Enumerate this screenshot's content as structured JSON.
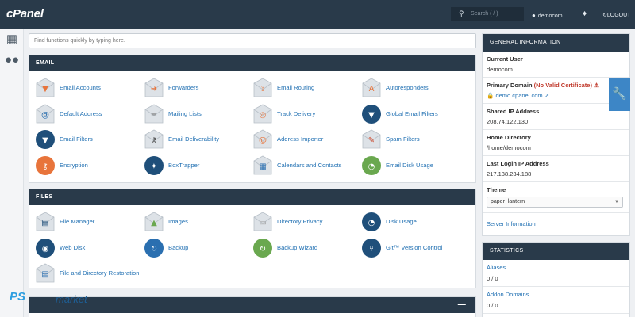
{
  "topbar": {
    "logo": "cPanel",
    "search_placeholder": "Search ( / )",
    "username": "democom",
    "logout": "LOGOUT"
  },
  "quickfind": {
    "placeholder": "Find functions quickly by typing here."
  },
  "email": {
    "title": "EMAIL",
    "items": [
      {
        "label": "Email Accounts",
        "icon": "mail-down-icon"
      },
      {
        "label": "Forwarders",
        "icon": "mail-forward-icon"
      },
      {
        "label": "Email Routing",
        "icon": "mail-routing-icon"
      },
      {
        "label": "Autoresponders",
        "icon": "mail-auto-icon"
      },
      {
        "label": "Default Address",
        "icon": "mail-at-icon"
      },
      {
        "label": "Mailing Lists",
        "icon": "mail-list-icon"
      },
      {
        "label": "Track Delivery",
        "icon": "mail-track-icon"
      },
      {
        "label": "Global Email Filters",
        "icon": "global-filter-icon"
      },
      {
        "label": "Email Filters",
        "icon": "filter-icon"
      },
      {
        "label": "Email Deliverability",
        "icon": "mail-key-icon"
      },
      {
        "label": "Address Importer",
        "icon": "mail-import-icon"
      },
      {
        "label": "Spam Filters",
        "icon": "spam-icon"
      },
      {
        "label": "Encryption",
        "icon": "key-icon"
      },
      {
        "label": "BoxTrapper",
        "icon": "boxtrapper-icon"
      },
      {
        "label": "Calendars and Contacts",
        "icon": "calendar-icon"
      },
      {
        "label": "Email Disk Usage",
        "icon": "mail-pie-icon"
      }
    ]
  },
  "files": {
    "title": "FILES",
    "items": [
      {
        "label": "File Manager",
        "icon": "file-manager-icon"
      },
      {
        "label": "Images",
        "icon": "images-icon"
      },
      {
        "label": "Directory Privacy",
        "icon": "folder-icon"
      },
      {
        "label": "Disk Usage",
        "icon": "disk-icon"
      },
      {
        "label": "Web Disk",
        "icon": "web-disk-icon"
      },
      {
        "label": "Backup",
        "icon": "backup-icon"
      },
      {
        "label": "Backup Wizard",
        "icon": "backup-wizard-icon"
      },
      {
        "label": "Git™ Version Control",
        "icon": "git-icon"
      },
      {
        "label": "File and Directory Restoration",
        "icon": "restore-icon"
      }
    ]
  },
  "sidebar": {
    "general_title": "GENERAL INFORMATION",
    "current_user_label": "Current User",
    "current_user": "democom",
    "primary_domain_label": "Primary Domain",
    "no_cert": "(No Valid Certificate)",
    "domain": "demo.cpanel.com",
    "shared_ip_label": "Shared IP Address",
    "shared_ip": "208.74.122.130",
    "home_dir_label": "Home Directory",
    "home_dir": "/home/democom",
    "last_ip_label": "Last Login IP Address",
    "last_ip": "217.138.234.188",
    "theme_label": "Theme",
    "theme": "paper_lantern",
    "server_info": "Server Information",
    "stats_title": "STATISTICS",
    "aliases_label": "Aliases",
    "aliases_value": "0 / 0",
    "addon_label": "Addon Domains",
    "addon_value": "0 / 0"
  },
  "watermark": {
    "brand1": "PS",
    "brand2": "market"
  },
  "colors": {
    "navbar": "#293a4a",
    "link": "#1f6fb2",
    "accent": "#3d86c6"
  }
}
